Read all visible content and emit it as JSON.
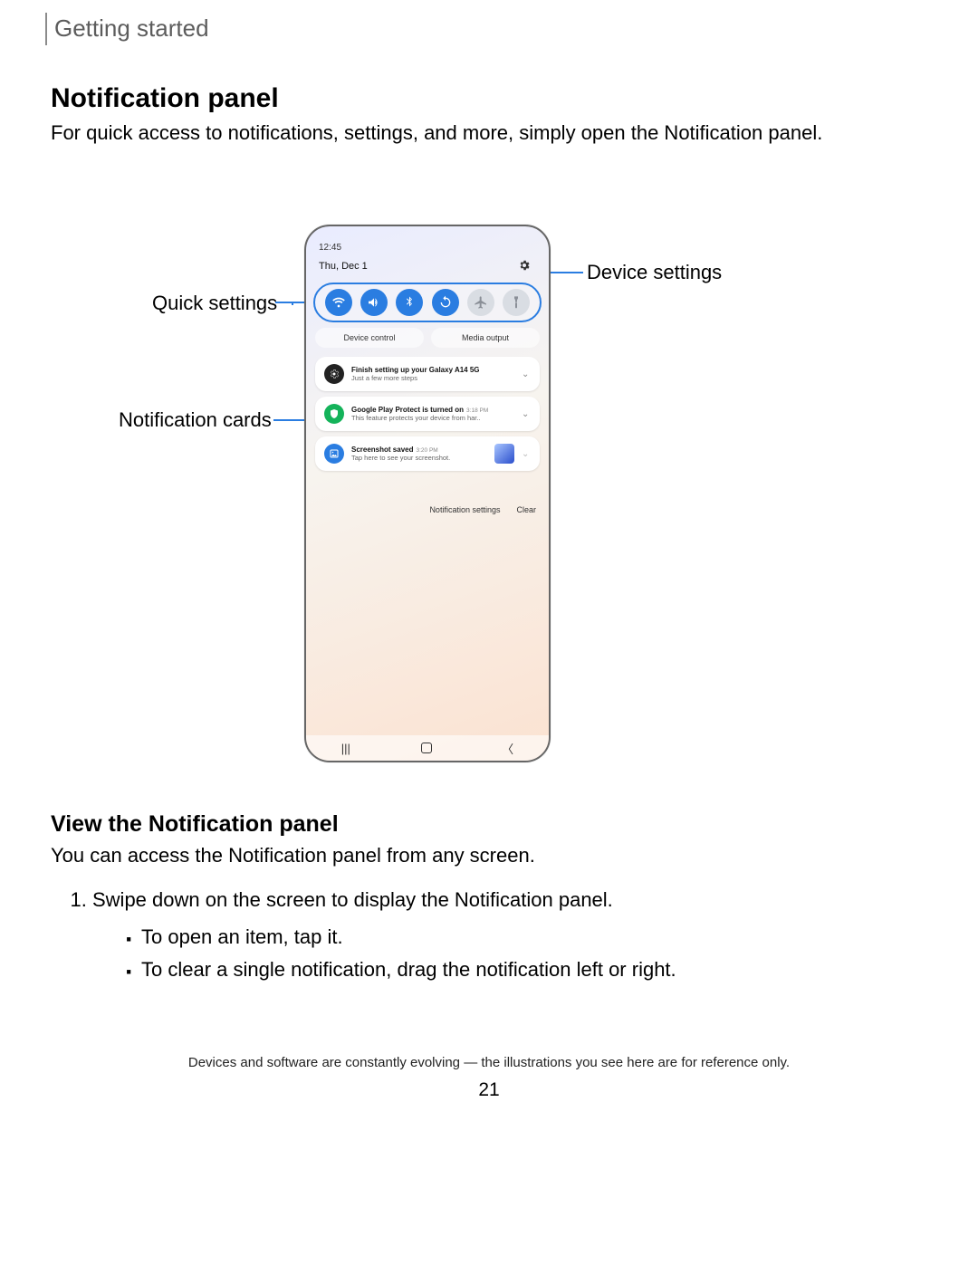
{
  "header": "Getting started",
  "title": "Notification panel",
  "intro": "For quick access to notifications, settings, and more, simply open the Notification panel.",
  "callouts": {
    "quick_settings": "Quick settings",
    "device_settings": "Device settings",
    "notification_cards": "Notification cards"
  },
  "phone": {
    "time": "12:45",
    "date": "Thu, Dec 1",
    "chips": {
      "device_control": "Device control",
      "media_output": "Media output"
    },
    "cards": [
      {
        "title": "Finish setting up your Galaxy A14 5G",
        "sub": "Just a few more steps",
        "time": ""
      },
      {
        "title": "Google Play Protect is turned on",
        "sub": "This feature protects your device from har..",
        "time": "3:18 PM"
      },
      {
        "title": "Screenshot saved",
        "sub": "Tap here to see your screenshot.",
        "time": "3:20 PM"
      }
    ],
    "actions": {
      "settings": "Notification settings",
      "clear": "Clear"
    }
  },
  "section2_title": "View the Notification panel",
  "section2_intro": "You can access the Notification panel from any screen.",
  "step1": "Swipe down on the screen to display the Notification panel.",
  "bullets": [
    "To open an item, tap it.",
    "To clear a single notification, drag the notification left or right."
  ],
  "footer": "Devices and software are constantly evolving — the illustrations you see here are for reference only.",
  "page": "21"
}
